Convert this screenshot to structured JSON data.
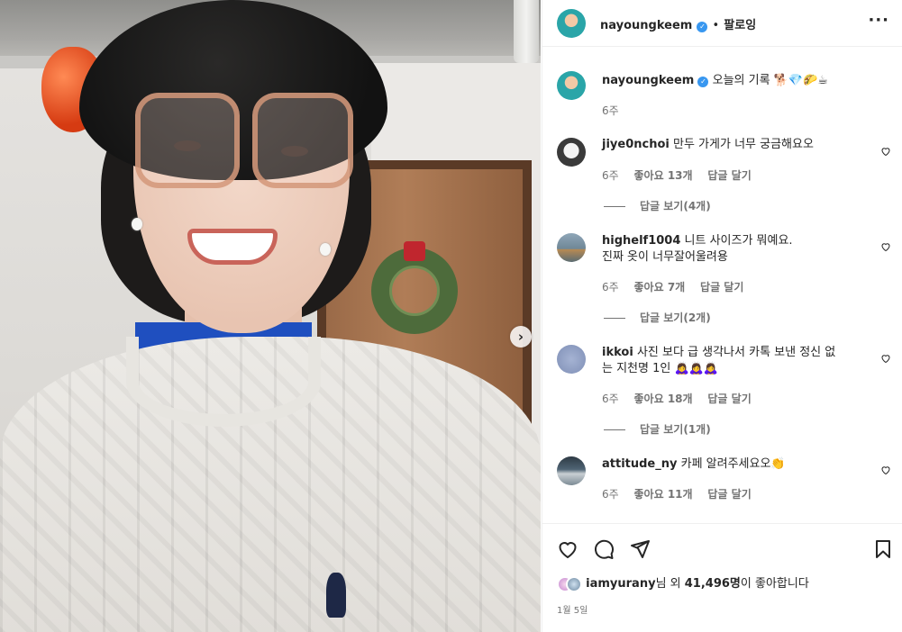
{
  "post": {
    "author": "nayoungkeem",
    "follow_label": "팔로잉",
    "dot": "•",
    "caption": "오늘의 기록 🐕💎🌮☕",
    "caption_time": "6주"
  },
  "comments": [
    {
      "user": "jiye0nchoi",
      "text": "만두 가게가 너무 궁금해요오",
      "time": "6주",
      "likes": "좋아요 13개",
      "reply": "답글 달기",
      "view_replies": "답글 보기(4개)"
    },
    {
      "user": "highelf1004",
      "text": "니트 사이즈가 뭐예요.",
      "text2": "진짜 옷이 너무잘어울려용",
      "time": "6주",
      "likes": "좋아요 7개",
      "reply": "답글 달기",
      "view_replies": "답글 보기(2개)"
    },
    {
      "user": "ikkoi",
      "text": "사진 보다 급 생각나서 카톡 보낸 정신 없",
      "text2": "는 지천명 1인 🙇‍♀️🙇‍♀️🙇‍♀️",
      "time": "6주",
      "likes": "좋아요 18개",
      "reply": "답글 달기",
      "view_replies": "답글 보기(1개)"
    },
    {
      "user": "attitude_ny",
      "text": "카페 알려주세요오👏",
      "time": "6주",
      "likes": "좋아요 11개",
      "reply": "답글 달기"
    }
  ],
  "likes": {
    "first_user": "iamyurany",
    "suffix_1": "님 외 ",
    "count": "41,496명",
    "suffix_2": "이 좋아합니다"
  },
  "date": "1월 5일",
  "icons": {
    "more": "···",
    "next": "›",
    "verified": "✓"
  }
}
